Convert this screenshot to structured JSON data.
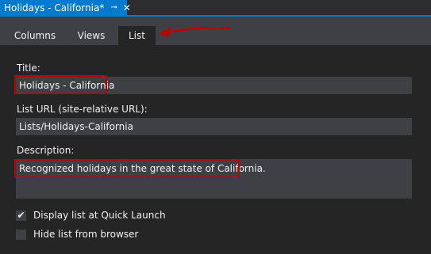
{
  "document_tab": {
    "title": "Holidays - California*",
    "pin_glyph": "⊸",
    "close_glyph": "✕"
  },
  "sub_tabs": [
    {
      "label": "Columns",
      "active": false
    },
    {
      "label": "Views",
      "active": false
    },
    {
      "label": "List",
      "active": true
    }
  ],
  "form": {
    "title_label": "Title:",
    "title_value": "Holidays - California",
    "url_label": "List URL (site-relative URL):",
    "url_value": "Lists/Holidays-California",
    "description_label": "Description:",
    "description_value": "Recognized holidays in the great state of California."
  },
  "options": {
    "quick_launch_label": "Display list at Quick Launch",
    "quick_launch_checked": true,
    "hide_list_label": "Hide list from browser",
    "hide_list_checked": false
  },
  "colors": {
    "accent": "#007acc",
    "annotation": "#c00000",
    "background": "#252526",
    "field_bg": "#3f3f46"
  }
}
